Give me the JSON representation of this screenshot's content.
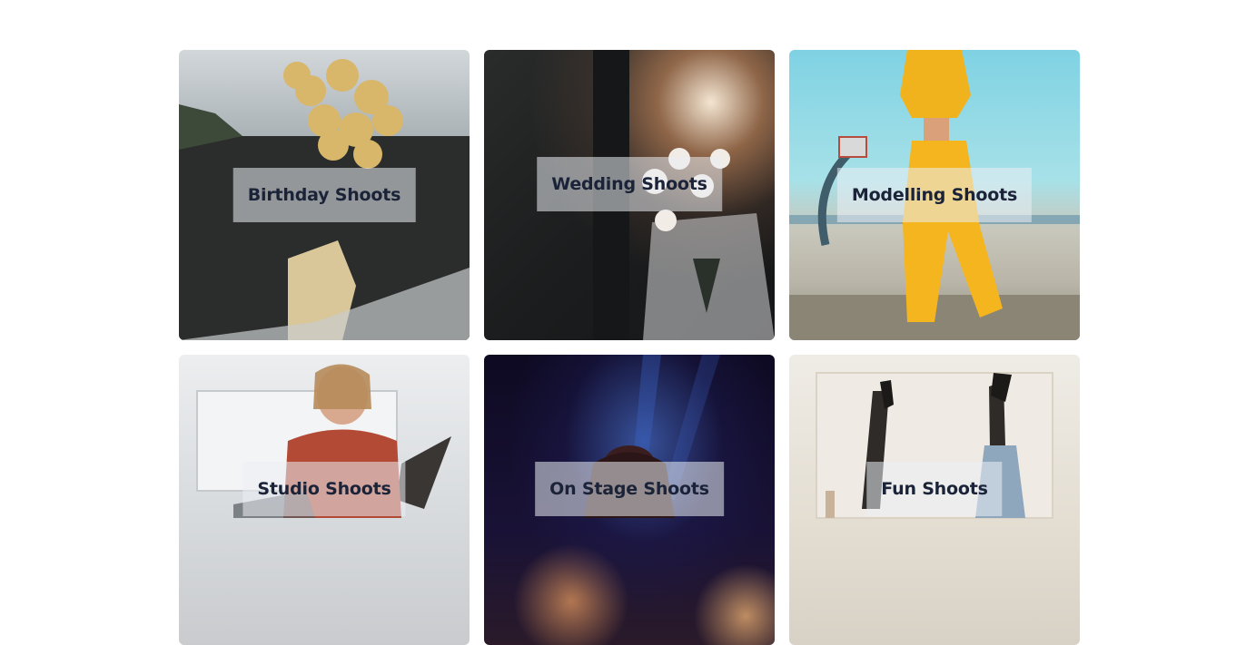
{
  "gallery": {
    "cards": [
      {
        "label": "Birthday Shoots"
      },
      {
        "label": "Wedding Shoots"
      },
      {
        "label": "Modelling Shoots"
      },
      {
        "label": "Studio Shoots"
      },
      {
        "label": "On Stage Shoots"
      },
      {
        "label": "Fun Shoots"
      }
    ]
  },
  "colors": {
    "caption_text": "#1b2338",
    "caption_bg": "rgba(235,238,244,0.55)",
    "page_bg": "#ffffff"
  }
}
